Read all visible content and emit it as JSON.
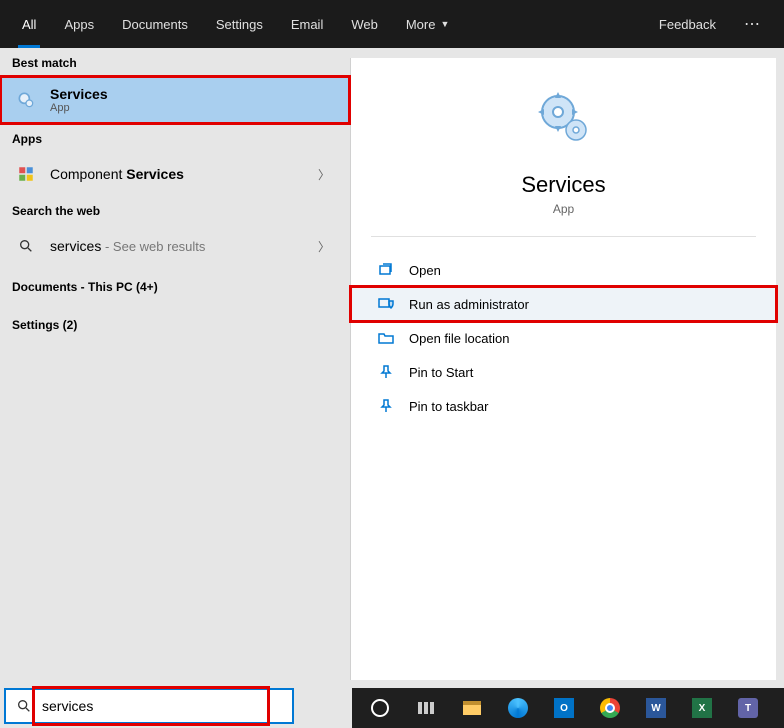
{
  "tabs": {
    "all": "All",
    "apps": "Apps",
    "documents": "Documents",
    "settings": "Settings",
    "email": "Email",
    "web": "Web",
    "more": "More",
    "feedback": "Feedback"
  },
  "left": {
    "best_match_header": "Best match",
    "best_match": {
      "title": "Services",
      "subtitle": "App"
    },
    "apps_header": "Apps",
    "apps_item": {
      "prefix": "Component ",
      "bold": "Services"
    },
    "search_web_header": "Search the web",
    "web_item": {
      "query": "services",
      "suffix": " - See web results"
    },
    "documents_header": "Documents - This PC (4+)",
    "settings_header": "Settings (2)"
  },
  "preview": {
    "title": "Services",
    "subtitle": "App"
  },
  "actions": {
    "open": "Open",
    "run_admin": "Run as administrator",
    "open_loc": "Open file location",
    "pin_start": "Pin to Start",
    "pin_taskbar": "Pin to taskbar"
  },
  "search": {
    "value": "services"
  }
}
